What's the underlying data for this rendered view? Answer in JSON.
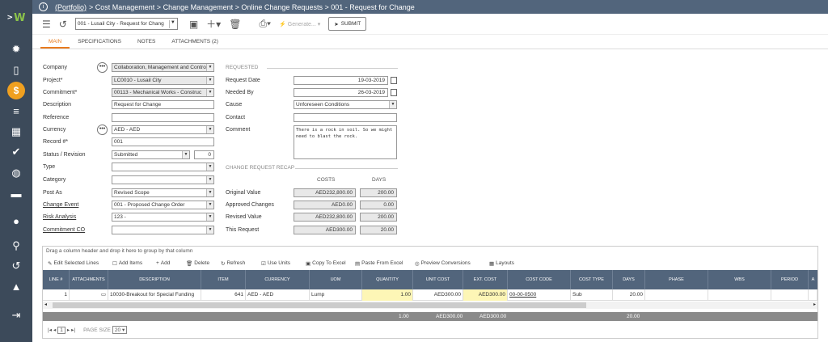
{
  "breadcrumb": {
    "portfolio": "(Portfolio)",
    "path": "> Cost Management > Change Management > Online Change Requests > 001 - Request for Change"
  },
  "toolbar": {
    "record_select": "001 - Lusail City - Request for Chang",
    "generate": "Generate...",
    "submit": "SUBMIT"
  },
  "tabs": [
    "MAIN",
    "SPECIFICATIONS",
    "NOTES",
    "ATTACHMENTS (2)"
  ],
  "form_left": {
    "company": {
      "label": "Company",
      "value": "Collaboration, Management and Control"
    },
    "project": {
      "label": "Project*",
      "value": "LC0010 - Lusail City"
    },
    "commitment": {
      "label": "Commitment*",
      "value": "00113 - Mechanical Works - Construc"
    },
    "description": {
      "label": "Description",
      "value": "Request for Change"
    },
    "reference": {
      "label": "Reference",
      "value": ""
    },
    "currency": {
      "label": "Currency",
      "value": "AED - AED"
    },
    "record": {
      "label": "Record #*",
      "value": "001"
    },
    "status": {
      "label": "Status / Revision",
      "value": "Submitted",
      "revision": "0"
    },
    "type": {
      "label": "Type",
      "value": ""
    },
    "category": {
      "label": "Category",
      "value": ""
    },
    "post_as": {
      "label": "Post As",
      "value": "Revised Scope"
    },
    "change_event": {
      "label": "Change Event",
      "value": "001 - Proposed Change Order"
    },
    "risk_analysis": {
      "label": "Risk Analysis",
      "value": "123 -"
    },
    "commitment_co": {
      "label": "Commitment CO",
      "value": ""
    }
  },
  "requested": {
    "section": "REQUESTED",
    "request_date": {
      "label": "Request Date",
      "value": "19-03-2019"
    },
    "needed_by": {
      "label": "Needed By",
      "value": "26-03-2019"
    },
    "cause": {
      "label": "Cause",
      "value": "Unforeseen Conditions"
    },
    "contact": {
      "label": "Contact",
      "value": ""
    },
    "comment": {
      "label": "Comment",
      "value": "There is a rock in soil. So we might need to blast the rock."
    }
  },
  "recap": {
    "section": "CHANGE REQUEST RECAP",
    "costs_header": "COSTS",
    "days_header": "DAYS",
    "rows": [
      {
        "label": "Original Value",
        "cost": "AED232,800.00",
        "days": "200.00"
      },
      {
        "label": "Approved Changes",
        "cost": "AED0.00",
        "days": "0.00"
      },
      {
        "label": "Revised Value",
        "cost": "AED232,800.00",
        "days": "200.00"
      },
      {
        "label": "This Request",
        "cost": "AED300.00",
        "days": "20.00"
      }
    ]
  },
  "grid": {
    "group_hint": "Drag a column header and drop it here to group by that column",
    "tools": [
      "Edit Selected Lines",
      "Add Items",
      "Add",
      "Delete",
      "Refresh",
      "Use Units",
      "Copy To Excel",
      "Paste From Excel",
      "Preview Conversions",
      "Layouts"
    ],
    "columns": [
      "LINE #",
      "ATTACHMENTS",
      "DESCRIPTION",
      "ITEM",
      "CURRENCY",
      "UOM",
      "QUANTITY",
      "UNIT COST",
      "EXT. COST",
      "COST CODE",
      "COST TYPE",
      "DAYS",
      "PHASE",
      "WBS",
      "PERIOD",
      "A"
    ],
    "row": [
      "1",
      "",
      "10030-Breakout for Special Funding",
      "641",
      "AED - AED",
      "Lump",
      "1.00",
      "AED300.00",
      "AED300.00",
      "00-00-0500",
      "Sub",
      "20.00",
      "",
      "",
      "",
      ""
    ],
    "footer": {
      "quantity": "1.00",
      "unit_cost": "AED300.00",
      "ext_cost": "AED300.00",
      "days": "20.00"
    },
    "pager": {
      "page": "1",
      "size_label": "PAGE SIZE",
      "size": "20"
    }
  }
}
